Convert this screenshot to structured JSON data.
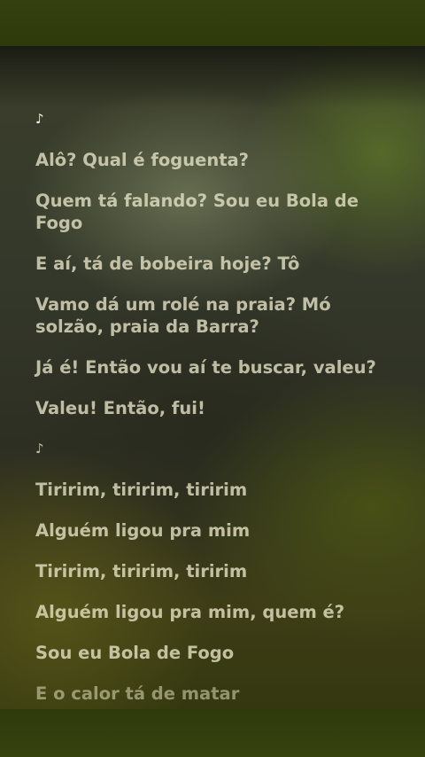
{
  "lyrics": {
    "lines": [
      "♪",
      "Alô? Qual é foguenta?",
      "Quem tá falando? Sou eu Bola de Fogo",
      "E aí, tá de bobeira hoje? Tô",
      "Vamo dá um rolé na praia? Mó solzão, praia da Barra?",
      "Já é! Então vou aí te buscar, valeu?",
      "Valeu! Então, fui!",
      "♪",
      "Tiririm, tiririm, tiririm",
      "Alguém ligou pra mim",
      "Tiririm, tiririm, tiririm",
      "Alguém ligou pra mim, quem é?",
      "Sou eu Bola de Fogo",
      "E o calor tá de matar"
    ]
  }
}
